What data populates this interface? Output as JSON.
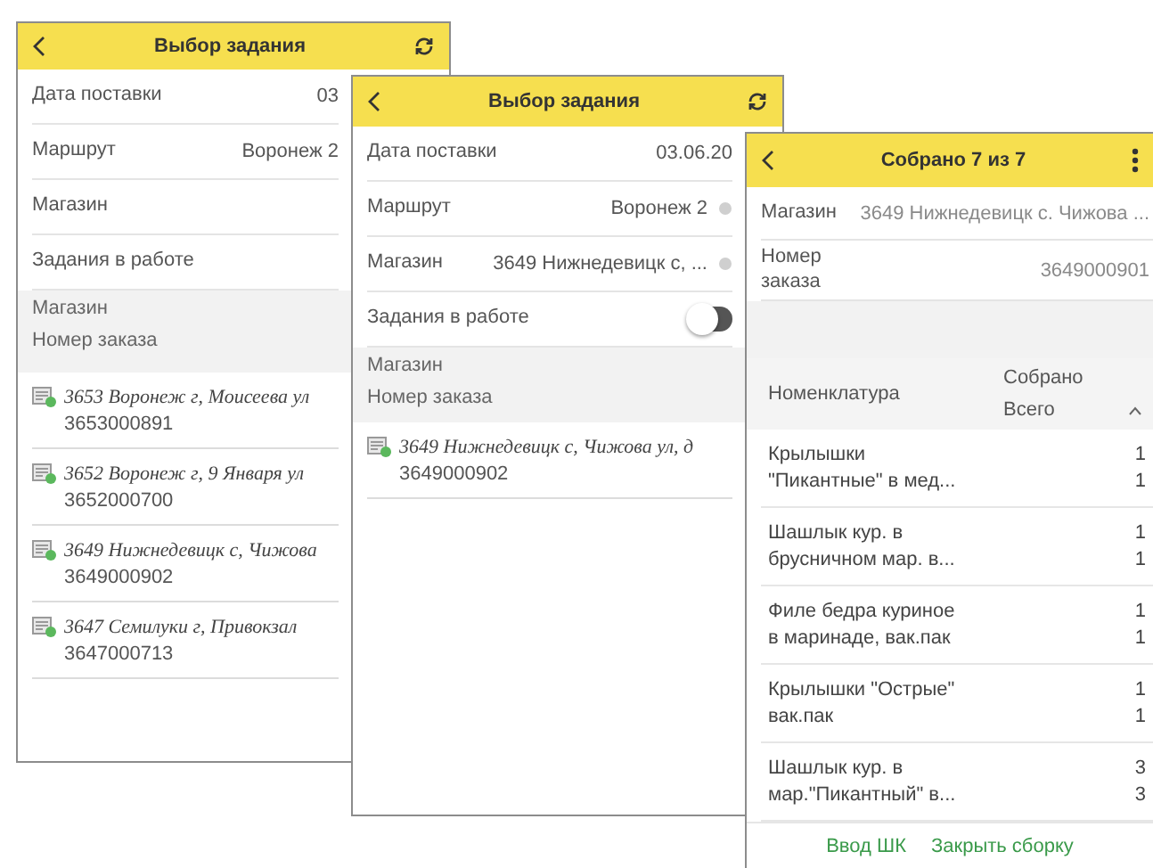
{
  "screens": [
    {
      "kind": "task_select",
      "title": "Выбор задания",
      "fields": [
        {
          "kind": "value",
          "label": "Дата поставки",
          "value": "03"
        },
        {
          "kind": "value",
          "label": "Маршрут",
          "value": "Воронеж 2"
        },
        {
          "kind": "value",
          "label": "Магазин"
        },
        {
          "kind": "value",
          "label": "Задания в работе"
        }
      ],
      "list_header": [
        "Магазин",
        "Номер заказа"
      ],
      "orders": [
        {
          "store": "3653 Воронеж г, Моисеева ул",
          "number": "3653000891"
        },
        {
          "store": "3652 Воронеж г, 9 Января ул",
          "number": "3652000700"
        },
        {
          "store": "3649 Нижнедевицк с, Чижова",
          "number": "3649000902"
        },
        {
          "store": "3647 Семилуки г, Привокзал",
          "number": "3647000713"
        }
      ]
    },
    {
      "kind": "task_select",
      "title": "Выбор задания",
      "fields": [
        {
          "kind": "value",
          "label": "Дата поставки",
          "value": "03.06.20"
        },
        {
          "kind": "value",
          "label": "Маршрут",
          "value": "Воронеж 2",
          "clearable": true
        },
        {
          "kind": "value",
          "label": "Магазин",
          "value": "3649 Нижнедевицк с, ...",
          "clearable": true
        },
        {
          "kind": "toggle",
          "label": "Задания в работе",
          "on": false
        }
      ],
      "list_header": [
        "Магазин",
        "Номер заказа"
      ],
      "orders": [
        {
          "store": "3649 Нижнедевицк с, Чижова ул, д",
          "number": "3649000902"
        }
      ]
    },
    {
      "kind": "assembly",
      "title": "Собрано 7 из 7",
      "fields": [
        {
          "kind": "value",
          "label": "Магазин",
          "value": "3649 Нижнедевицк с. Чижова ..."
        },
        {
          "kind": "value",
          "label": "Номер заказа",
          "value": "3649000901"
        }
      ],
      "table": {
        "columns": [
          "Номенклатура",
          "Собрано",
          "Всего"
        ],
        "rows": [
          {
            "name": "Крылышки \"Пикантные\" в мед...",
            "collected": "1",
            "total": "1"
          },
          {
            "name": "Шашлык кур. в брусничном мар. в...",
            "collected": "1",
            "total": "1"
          },
          {
            "name": "Филе бедра куриное в маринаде, вак.пак",
            "collected": "1",
            "total": "1"
          },
          {
            "name": "Крылышки \"Острые\" вак.пак",
            "collected": "1",
            "total": "1"
          },
          {
            "name": "Шашлык кур. в мар.\"Пикантный\" в...",
            "collected": "3",
            "total": "3"
          }
        ]
      },
      "buttons": [
        "Ввод ШК",
        "Закрыть сборку"
      ]
    }
  ]
}
